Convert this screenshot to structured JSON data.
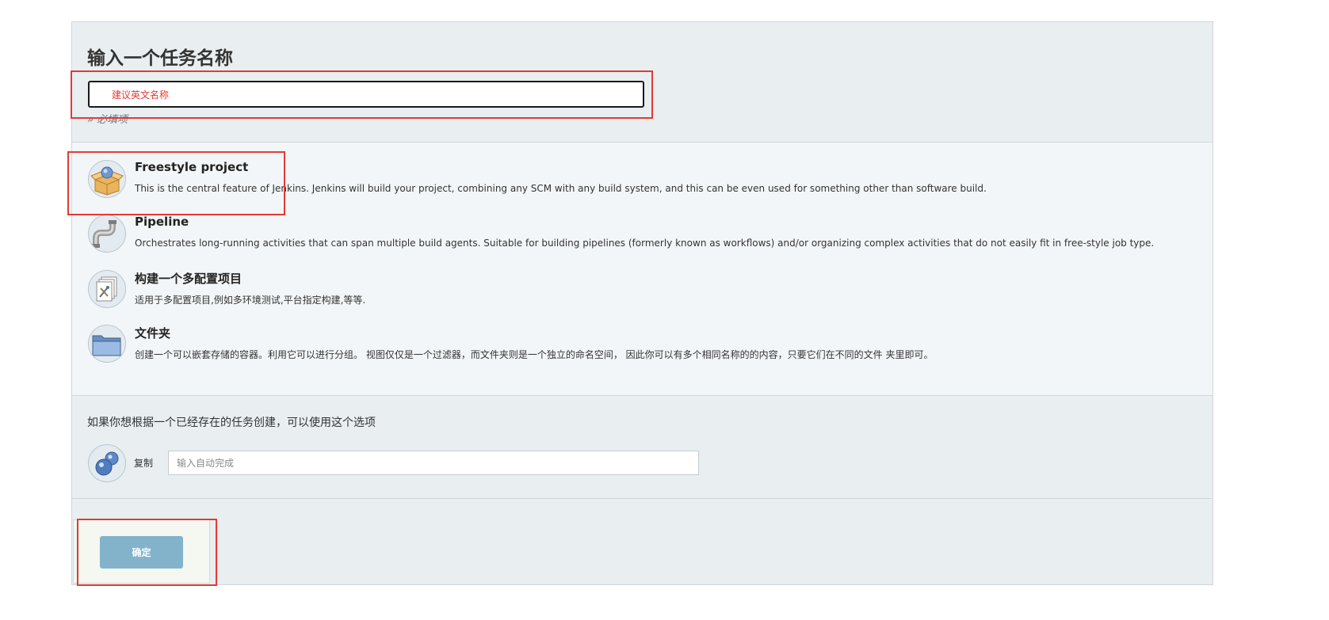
{
  "title": "输入一个任务名称",
  "name_input": {
    "placeholder": "建议英文名称"
  },
  "required_note": "» 必填项",
  "item_types": [
    {
      "icon": "freestyle-box-icon",
      "name": "Freestyle project",
      "description": "This is the central feature of Jenkins. Jenkins will build your project, combining any SCM with any build system, and this can be even used for something other than software build."
    },
    {
      "icon": "pipeline-pipe-icon",
      "name": "Pipeline",
      "description": "Orchestrates long-running activities that can span multiple build agents. Suitable for building pipelines (formerly known as workflows) and/or organizing complex activities that do not easily fit in free-style job type."
    },
    {
      "icon": "multi-config-icon",
      "name": "构建一个多配置项目",
      "description": "适用于多配置项目,例如多环境测试,平台指定构建,等等."
    },
    {
      "icon": "folder-icon",
      "name": "文件夹",
      "description": "创建一个可以嵌套存储的容器。利用它可以进行分组。 视图仅仅是一个过滤器，而文件夹则是一个独立的命名空间， 因此你可以有多个相同名称的的内容，只要它们在不同的文件 夹里即可。"
    }
  ],
  "copy_section": {
    "heading": "如果你想根据一个已经存在的任务创建，可以使用这个选项",
    "label": "复制",
    "placeholder": "输入自动完成",
    "icon": "copy-spheres-icon"
  },
  "ok_button": "确定",
  "colors": {
    "panel_bg": "#e9eef1",
    "types_bg": "#f3f6f8",
    "button_bg": "#82b3cb",
    "highlight": "#e53935",
    "hint_text": "#e53935"
  }
}
